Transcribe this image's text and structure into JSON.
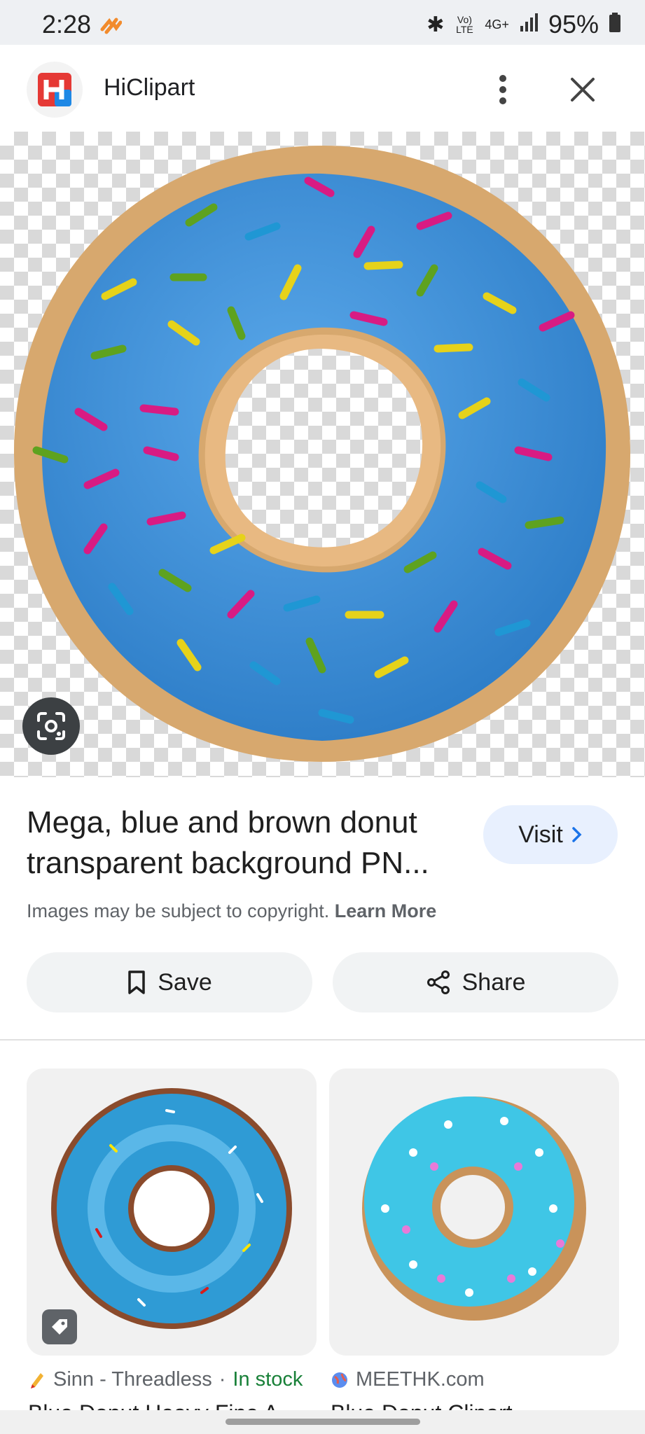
{
  "status_bar": {
    "time": "2:28",
    "battery": "95%",
    "network": "4G+",
    "volte": "Vo) LTE"
  },
  "header": {
    "site_name": "HiClipart",
    "logo_letter": "H"
  },
  "image": {
    "subject": "blue donut with sprinkles on transparent background",
    "glaze_color": "#3a8ed8",
    "dough_color": "#d9aa72"
  },
  "title": "Mega, blue and brown donut transparent background PN...",
  "visit_label": "Visit",
  "copyright": {
    "text": "Images may be subject to copyright.",
    "link": "Learn More"
  },
  "actions": {
    "save": "Save",
    "share": "Share"
  },
  "related": [
    {
      "source": "Sinn - Threadless",
      "separator": "·",
      "availability": "In stock",
      "title": "Blue Donut Heavy Fine A..."
    },
    {
      "source": "MEETHK.com",
      "title": "Blue Donut Clipart"
    }
  ],
  "icons": {
    "more": "more-vert-icon",
    "close": "close-icon",
    "lens": "lens-icon",
    "save": "bookmark-icon",
    "share": "share-icon",
    "visit": "chevron-right-icon",
    "tag": "tag-icon"
  }
}
